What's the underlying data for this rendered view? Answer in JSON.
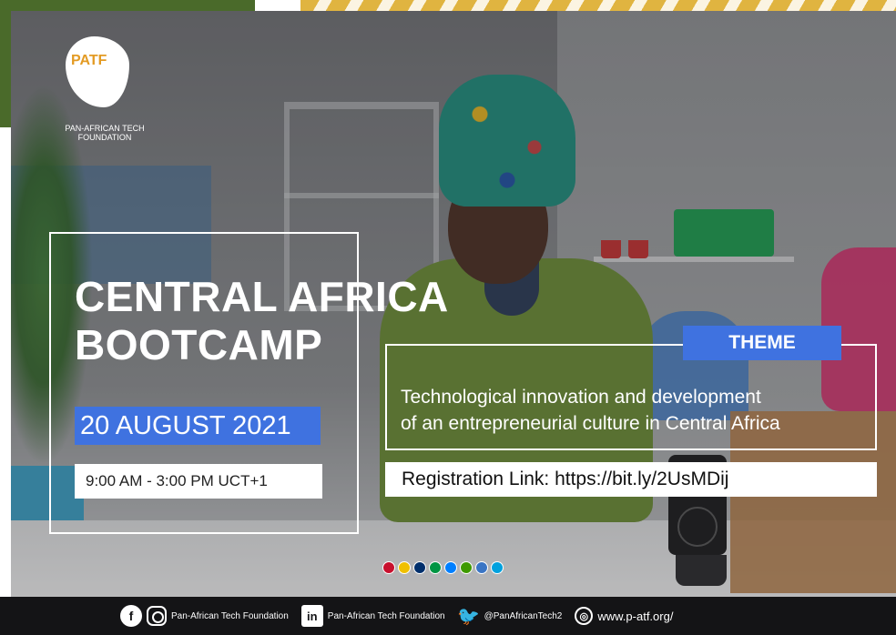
{
  "logo": {
    "mark": "PATF",
    "caption": "Pan-African Tech Foundation"
  },
  "event": {
    "title_line1": "CENTRAL AFRICA",
    "title_line2": "BOOTCAMP",
    "date": "20 AUGUST 2021",
    "time": "9:00 AM - 3:00 PM  UCT+1"
  },
  "theme": {
    "badge": "THEME",
    "line1": "Technological innovation and development",
    "line2": "of an entrepreneurial culture in Central Africa"
  },
  "registration": {
    "text": "Registration Link: https://bit.ly/2UsMDij"
  },
  "flags": [
    "cameroon",
    "central-african-republic",
    "chad",
    "congo",
    "dr-congo",
    "equatorial-guinea",
    "gabon",
    "rwanda"
  ],
  "flag_colors": [
    "#c8102e",
    "#f0c000",
    "#002f6c",
    "#009543",
    "#007fff",
    "#3e9a00",
    "#3a75c4",
    "#00a1de"
  ],
  "footer": {
    "fb_ig_label": "Pan-African Tech Foundation",
    "linkedin_label": "Pan-African Tech Foundation",
    "twitter_label": "@PanAfricanTech2",
    "website": "www.p-atf.org/"
  },
  "colors": {
    "accent_blue": "#3f72e0",
    "logo_orange": "#e39b24",
    "footer_bg": "#141416",
    "frame_green": "#4a6a2a",
    "frame_gold": "#e0b440"
  }
}
